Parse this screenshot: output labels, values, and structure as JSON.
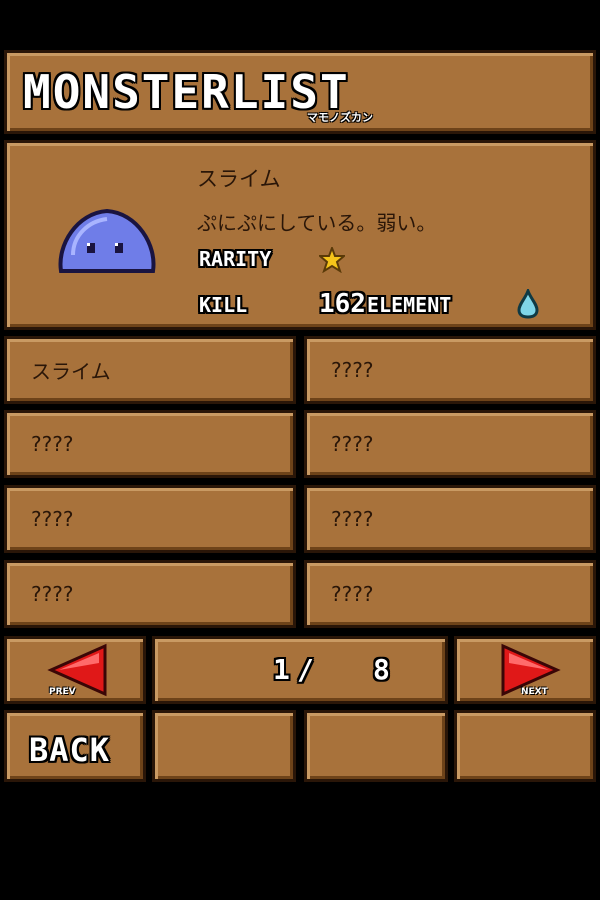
{
  "header": {
    "title": "MONSTERLIST",
    "subtitle": "マモノズカン"
  },
  "detail": {
    "name": "スライム",
    "description": "ぷにぷにしている。弱い。",
    "rarity_label": "RARITY",
    "rarity_stars": 1,
    "kill_label": "KILL",
    "kill_count": "162",
    "element_label": "ELEMENT",
    "element_icon": "water-drop-icon",
    "colors": {
      "slime": "#6f7de8",
      "star": "#f5c41a",
      "drop": "#7fd6e8"
    }
  },
  "list": [
    "スライム",
    "????",
    "????",
    "????",
    "????",
    "????",
    "????",
    "????"
  ],
  "pager": {
    "prev_label": "PREV",
    "next_label": "NEXT",
    "current": "1",
    "separator": "/",
    "total": "8"
  },
  "back_label": "BACK"
}
